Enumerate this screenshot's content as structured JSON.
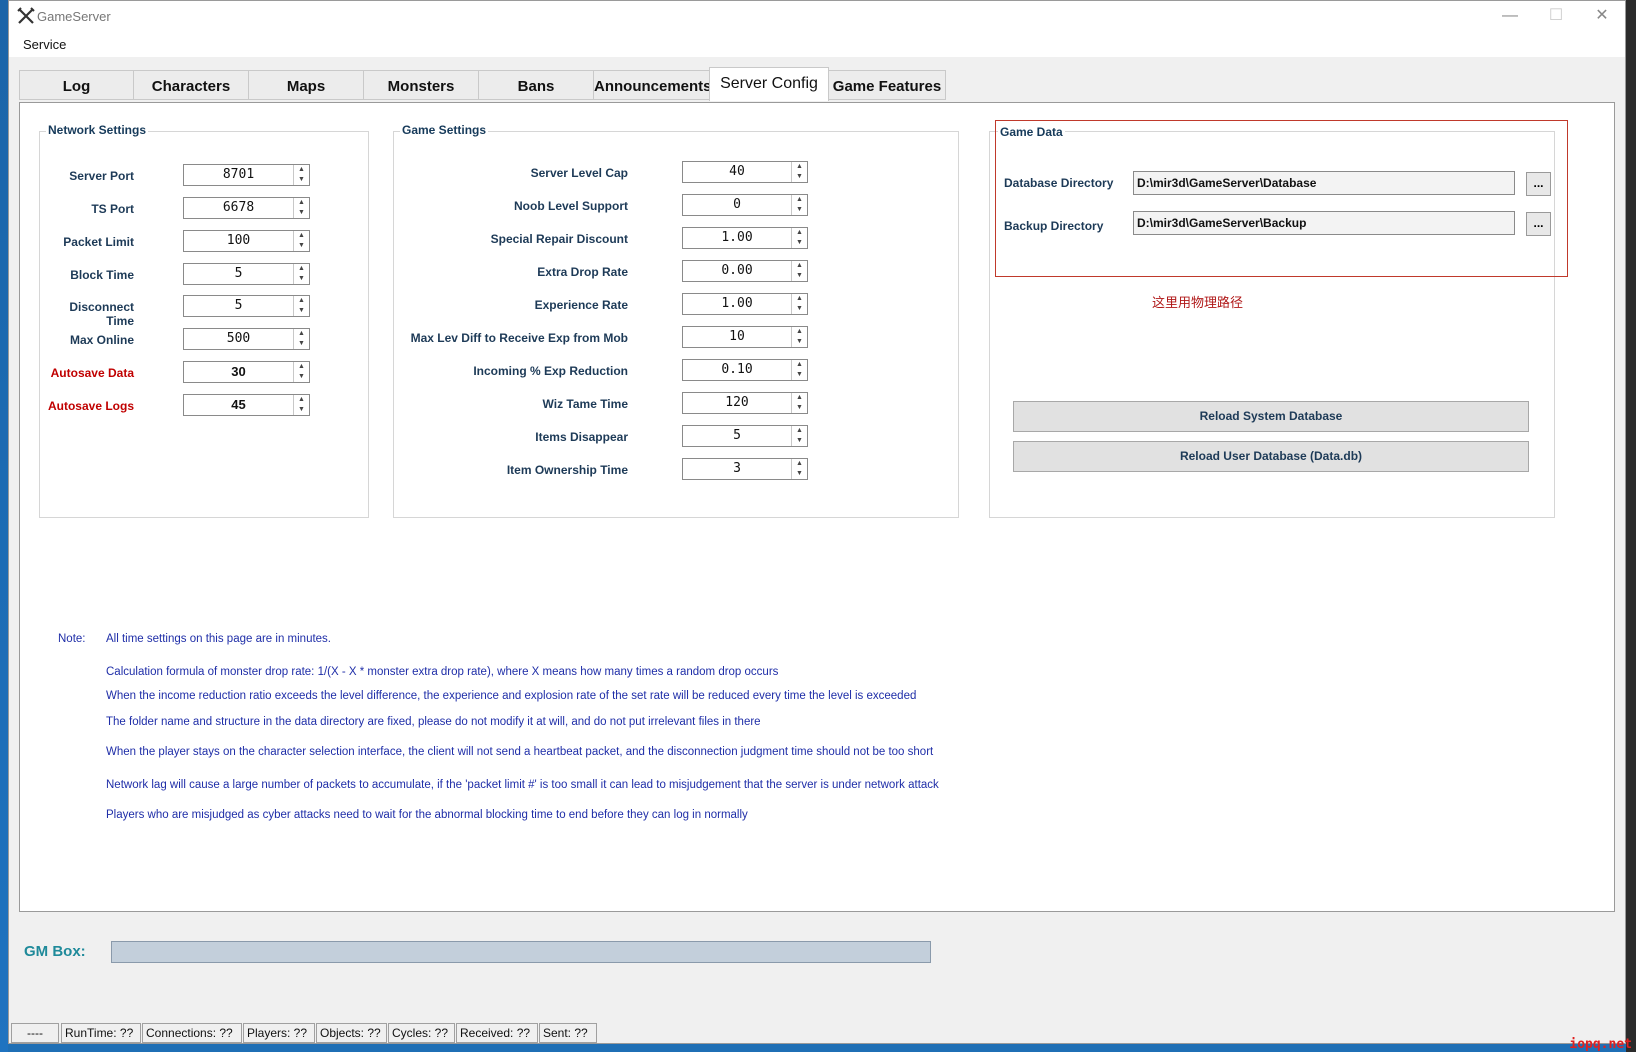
{
  "window": {
    "title": "GameServer"
  },
  "menu": {
    "service": "Service"
  },
  "tabs": [
    "Log",
    "Characters",
    "Maps",
    "Monsters",
    "Bans",
    "Announcements",
    "Server Config",
    "Game Features"
  ],
  "network": {
    "title": "Network Settings",
    "fields": [
      {
        "label": "Server Port",
        "value": "8701"
      },
      {
        "label": "TS Port",
        "value": "6678"
      },
      {
        "label": "Packet Limit",
        "value": "100"
      },
      {
        "label": "Block Time",
        "value": "5"
      },
      {
        "label": "Disconnect Time",
        "value": "5"
      },
      {
        "label": "Max Online",
        "value": "500"
      },
      {
        "label": "Autosave Data",
        "value": "30"
      },
      {
        "label": "Autosave Logs",
        "value": "45"
      }
    ]
  },
  "game": {
    "title": "Game Settings",
    "fields": [
      {
        "label": "Server Level Cap",
        "value": "40"
      },
      {
        "label": "Noob Level Support",
        "value": "0"
      },
      {
        "label": "Special Repair Discount",
        "value": "1.00"
      },
      {
        "label": "Extra Drop Rate",
        "value": "0.00"
      },
      {
        "label": "Experience Rate",
        "value": "1.00"
      },
      {
        "label": "Max Lev Diff to Receive Exp from Mob",
        "value": "10"
      },
      {
        "label": "Incoming % Exp Reduction",
        "value": "0.10"
      },
      {
        "label": "Wiz Tame Time",
        "value": "120"
      },
      {
        "label": "Items Disappear",
        "value": "5"
      },
      {
        "label": "Item Ownership Time",
        "value": "3"
      }
    ]
  },
  "gamedata": {
    "title": "Game Data",
    "db_label": "Database Directory",
    "db_path": "D:\\mir3d\\GameServer\\Database",
    "backup_label": "Backup Directory",
    "backup_path": "D:\\mir3d\\GameServer\\Backup",
    "browse": "...",
    "hint": "这里用物理路径",
    "reload_system": "Reload System Database",
    "reload_user": "Reload User Database (Data.db)"
  },
  "notes": {
    "label": "Note:",
    "lines": [
      "All time settings on this page are in minutes.",
      "Calculation formula of monster drop rate: 1/(X - X * monster extra drop rate), where X means how many times a random drop occurs",
      "When the income reduction ratio exceeds the level difference, the experience and explosion rate of the set rate will be reduced every time the level is exceeded",
      "The folder name and structure in the data directory are fixed, please do not modify it at will, and do not put irrelevant files in there",
      "When the player stays on the character selection interface, the client will not send a heartbeat packet, and the disconnection judgment time should not be too short",
      "Network lag will cause a large number of packets to accumulate, if the 'packet limit #' is too small it can lead to misjudgement that the server is under network attack",
      "Players who are misjudged as cyber attacks need to wait for the abnormal blocking time to end before they can log in normally"
    ]
  },
  "gm": {
    "label": "GM Box:"
  },
  "status": [
    "----",
    "RunTime: ??",
    "Connections: ??",
    "Players: ??",
    "Objects: ??",
    "Cycles: ??",
    "Received: ??",
    "Sent: ??"
  ],
  "watermark": "iopq.net",
  "colors": {
    "accent_red": "#c00000",
    "note_blue": "#1f2ea8",
    "label_navy": "#1d3a57"
  }
}
